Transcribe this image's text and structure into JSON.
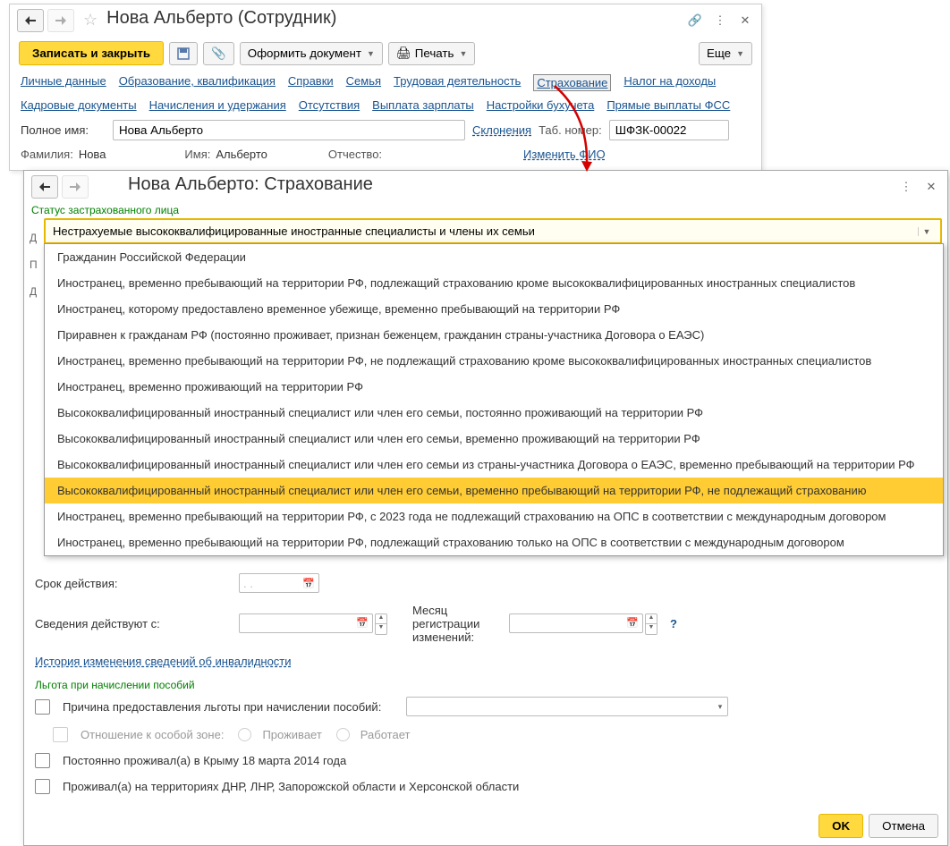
{
  "win1": {
    "title": "Нова Альберто (Сотрудник)",
    "toolbar": {
      "save_close": "Записать и закрыть",
      "doc_menu": "Оформить документ",
      "print": "Печать",
      "more": "Еще"
    },
    "links_row1": [
      "Личные данные",
      "Образование, квалификация",
      "Справки",
      "Семья",
      "Трудовая деятельность",
      "Страхование",
      "Налог на доходы"
    ],
    "links_row2": [
      "Кадровые документы",
      "Начисления и удержания",
      "Отсутствия",
      "Выплата зарплаты",
      "Настройки бухучета",
      "Прямые выплаты ФСС"
    ],
    "fullname_label": "Полное имя:",
    "fullname_value": "Нова Альберто",
    "declension_link": "Склонения",
    "tabnum_label": "Таб. номер:",
    "tabnum_value": "ШФЗК-00022",
    "surname_label": "Фамилия:",
    "surname_value": "Нова",
    "name_label": "Имя:",
    "name_value": "Альберто",
    "patronymic_label": "Отчество:",
    "change_fio": "Изменить ФИО"
  },
  "win2": {
    "title": "Нова Альберто: Страхование",
    "section_title": "Статус застрахованного лица",
    "combo_value": "Нестрахуемые высококвалифицированные иностранные специалисты и члены их семьи",
    "left_labels": [
      "Д",
      "П",
      "Д"
    ],
    "dropdown_items": [
      "Гражданин Российской Федерации",
      "Иностранец, временно пребывающий на территории РФ, подлежащий страхованию кроме высококвалифицированных иностранных специалистов",
      "Иностранец, которому предоставлено временное убежище, временно пребывающий на территории РФ",
      "Приравнен к гражданам РФ (постоянно проживает, признан беженцем, гражданин страны-участника Договора о ЕАЭС)",
      "Иностранец, временно пребывающий на территории РФ, не подлежащий страхованию кроме высококвалифицированных иностранных специалистов",
      "Иностранец, временно проживающий на территории РФ",
      "Высококвалифицированный иностранный специалист или член его семьи, постоянно проживающий на территории РФ",
      "Высококвалифицированный иностранный специалист или член его семьи, временно проживающий на территории РФ",
      "Высококвалифицированный иностранный специалист или член его семьи из страны-участника Договора о ЕАЭС, временно пребывающий на территории РФ",
      "Высококвалифицированный иностранный специалист или член его семьи, временно пребывающий на территории РФ, не подлежащий страхованию",
      "Иностранец, временно пребывающий на территории РФ, с 2023 года не подлежащий страхованию на ОПС в соответствии с международным договором",
      "Иностранец, временно пребывающий на территории РФ, подлежащий страхованию только на ОПС в соответствии с международным договором"
    ],
    "dropdown_selected_index": 9,
    "validity_label": "Срок действия:",
    "info_from_label": "Сведения действуют с:",
    "reg_month_label": "Месяц регистрации изменений:",
    "history_link": "История изменения сведений об инвалидности",
    "benefit_section": "Льгота при начислении пособий",
    "benefit_reason_label": "Причина предоставления льготы при начислении пособий:",
    "zone_label": "Отношение к особой зоне:",
    "zone_opt1": "Проживает",
    "zone_opt2": "Работает",
    "crimea_label": "Постоянно проживал(а) в Крыму 18 марта 2014 года",
    "dnr_label": "Проживал(а) на территориях ДНР, ЛНР, Запорожской области и Херсонской области",
    "ok": "OK",
    "cancel": "Отмена",
    "date_placeholder": ". ."
  }
}
